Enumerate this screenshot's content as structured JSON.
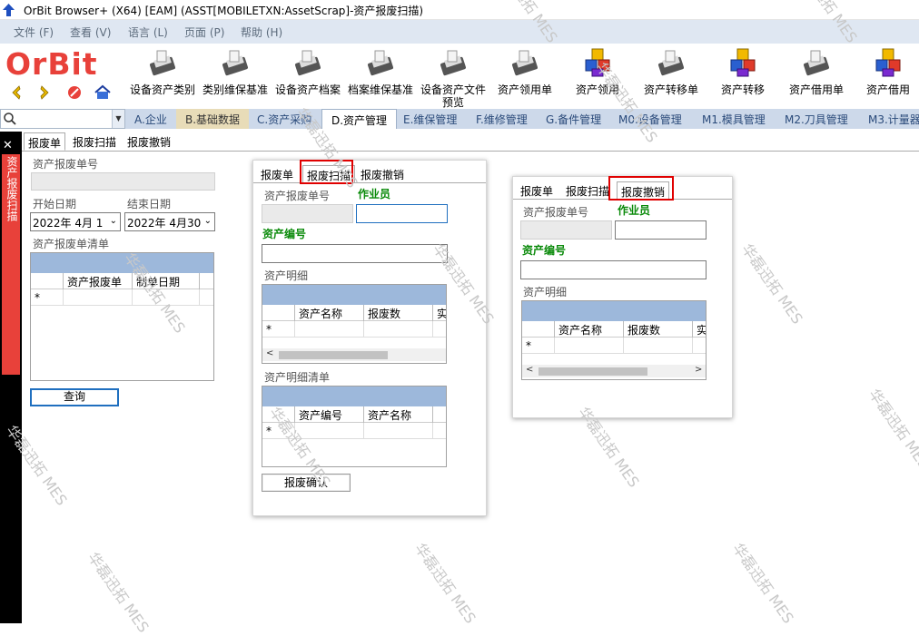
{
  "window": {
    "title": "OrBit Browser+ (X64) [EAM] (ASST[MOBILETXN:AssetScrap]-资产报废扫描)"
  },
  "menu": [
    "文件 (F)",
    "查看 (V)",
    "语言 (L)",
    "页面 (P)",
    "帮助 (H)"
  ],
  "logo": {
    "text": "OrBit"
  },
  "toolbar": [
    {
      "label": "设备资产类别",
      "icon": "scanner-icon"
    },
    {
      "label": "类别维保基准",
      "icon": "scanner-icon"
    },
    {
      "label": "设备资产档案",
      "icon": "scanner-icon"
    },
    {
      "label": "档案维保基准",
      "icon": "scanner-icon"
    },
    {
      "label": "设备资产文件预览",
      "icon": "scanner-icon"
    },
    {
      "label": "资产领用单",
      "icon": "scanner-icon"
    },
    {
      "label": "资产领用",
      "icon": "cubes-icon"
    },
    {
      "label": "资产转移单",
      "icon": "scanner-icon"
    },
    {
      "label": "资产转移",
      "icon": "cubes-icon"
    },
    {
      "label": "资产借用单",
      "icon": "scanner-icon"
    },
    {
      "label": "资产借用",
      "icon": "cubes-icon"
    }
  ],
  "modules": [
    "A.企业",
    "B.基础数据",
    "C.资产采购",
    "D.资产管理",
    "E.维保管理",
    "F.维修管理",
    "G.备件管理",
    "M0.设备管理",
    "M1.模具管理",
    "M2.刀具管理",
    "M3.计量器"
  ],
  "sidebar": {
    "tab": "资产报废扫描"
  },
  "main": {
    "tabs": [
      "报废单",
      "报废扫描",
      "报废撤销"
    ],
    "order_no_label": "资产报废单号",
    "start_label": "开始日期",
    "end_label": "结束日期",
    "start_value": "2022年  4月 1",
    "end_value": "2022年  4月30",
    "list_label": "资产报废单清单",
    "cols": [
      "资产报废单",
      "制单日期"
    ],
    "query": "查询"
  },
  "scan": {
    "tabs": [
      "报废单",
      "报废扫描",
      "报废撤销"
    ],
    "order_no_label": "资产报废单号",
    "operator_label": "作业员",
    "asset_no_label": "资产编号",
    "detail_label": "资产明细",
    "detail_cols": [
      "资产名称",
      "报废数",
      "实"
    ],
    "list_label": "资产明细清单",
    "list_cols": [
      "资产编号",
      "资产名称"
    ],
    "confirm": "报废确认"
  },
  "cancel": {
    "tabs": [
      "报废单",
      "报废扫描",
      "报废撤销"
    ],
    "order_no_label": "资产报废单号",
    "operator_label": "作业员",
    "asset_no_label": "资产编号",
    "detail_label": "资产明细",
    "detail_cols": [
      "资产名称",
      "报废数",
      "实"
    ]
  },
  "grid_new_row": "*",
  "watermark": "华磊迅拓 MES",
  "colors": {
    "accent_red": "#e00000",
    "header_blue": "#9db8db",
    "green_label": "#0a8a0a"
  }
}
